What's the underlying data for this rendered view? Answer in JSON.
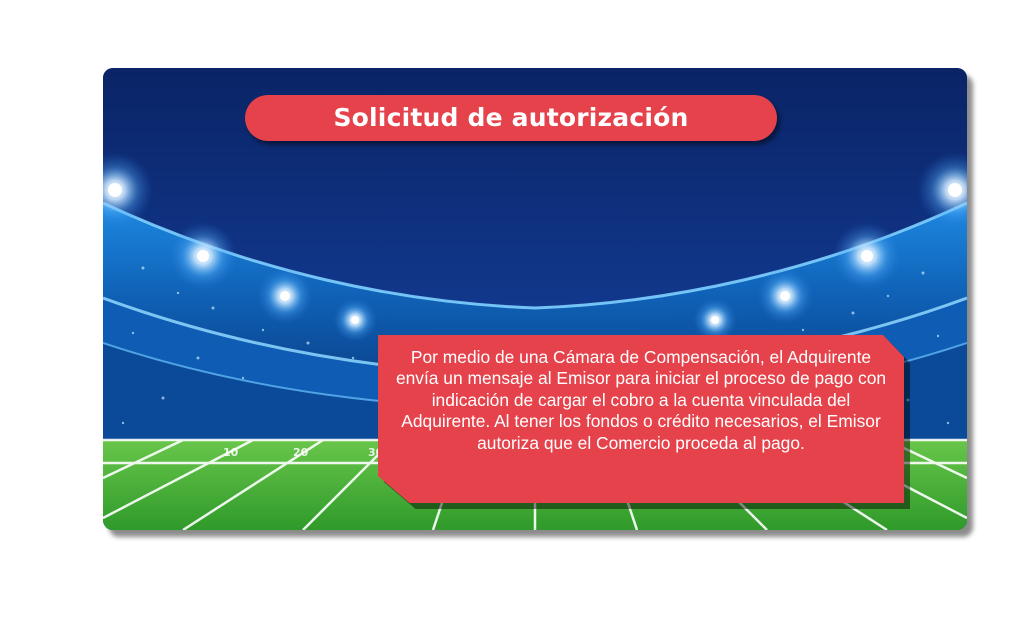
{
  "slide": {
    "title": "Solicitud de autorización",
    "description": "Por medio de una Cámara de Compensación, el Adquirente envía un mensaje al Emisor para iniciar el proceso de pago con indicación de cargar el cobro a la cuenta vinculada del Adquirente. Al tener los fondos o crédito necesarios, el Emisor autoriza que el Comercio proceda al pago."
  },
  "scene": {
    "subject": "stadium-background",
    "colors": {
      "sky_top": "#0a2466",
      "sky_bottom": "#1a5fc8",
      "stands": "#1c8fe0",
      "field": "#4fb83a",
      "accent_red": "#e5424b"
    },
    "field_numbers": [
      "10",
      "20",
      "30"
    ]
  }
}
